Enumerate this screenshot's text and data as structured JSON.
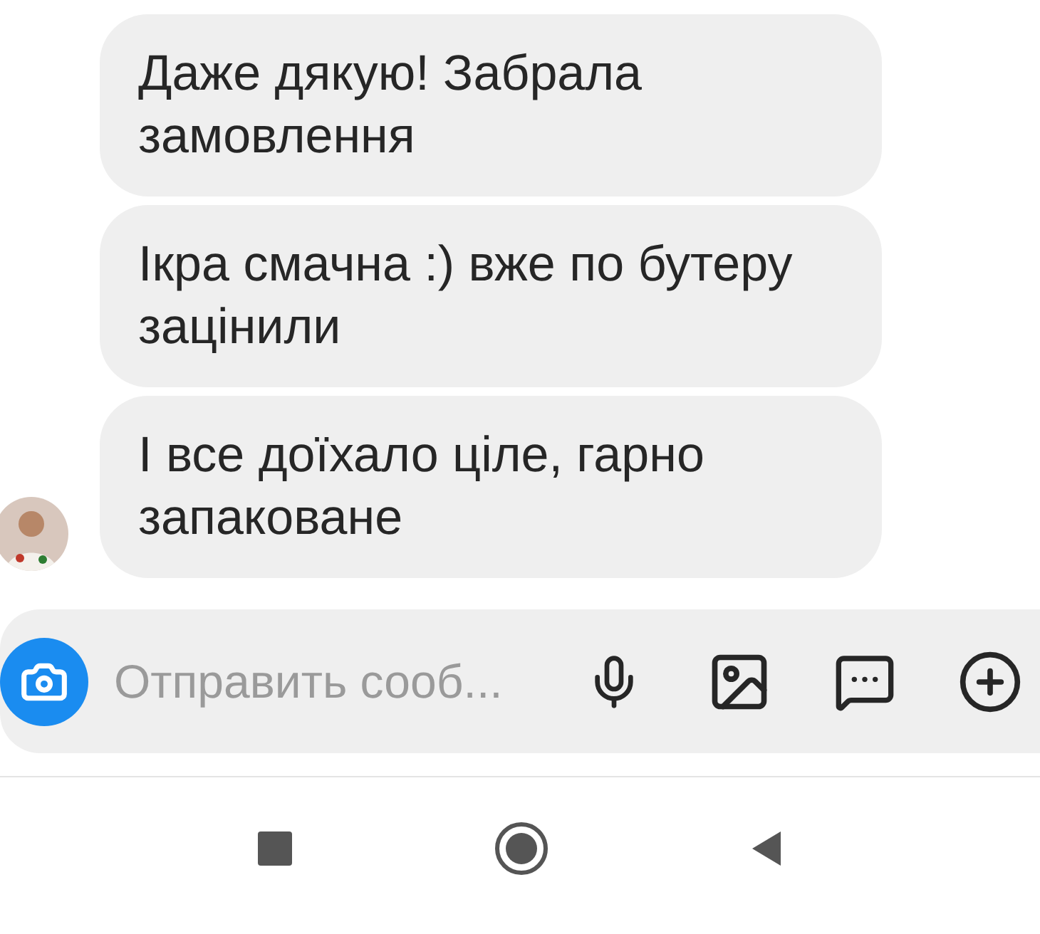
{
  "messages": [
    {
      "text": "Даже дякую! Забрала замовлення",
      "show_avatar": false
    },
    {
      "text": "Ікра смачна :) вже по бутеру зацінили",
      "show_avatar": false
    },
    {
      "text": "І все доїхало ціле, гарно запаковане",
      "show_avatar": true
    }
  ],
  "composer": {
    "placeholder": "Отправить сооб..."
  }
}
